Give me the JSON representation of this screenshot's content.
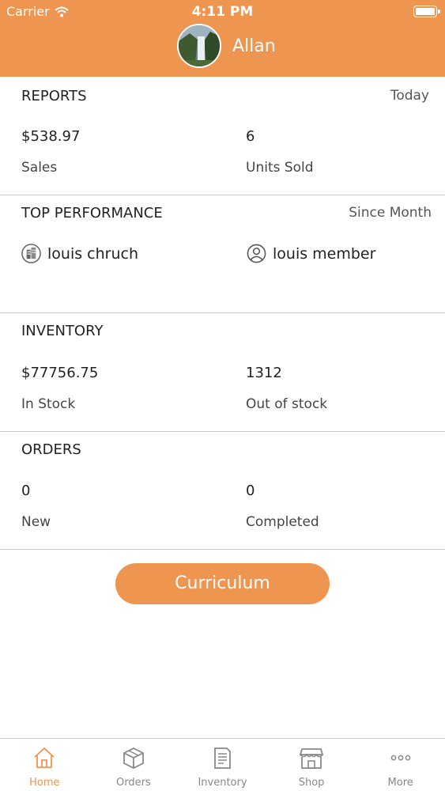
{
  "status_bar": {
    "carrier": "Carrier",
    "time": "4:11 PM"
  },
  "header": {
    "user_name": "Allan"
  },
  "reports": {
    "title": "REPORTS",
    "period": "Today",
    "sales_value": "$538.97",
    "sales_label": "Sales",
    "units_value": "6",
    "units_label": "Units Sold"
  },
  "top_performance": {
    "title": "TOP PERFORMANCE",
    "period": "Since Month",
    "store_name": "louis chruch",
    "member_name": "louis member"
  },
  "inventory": {
    "title": "INVENTORY",
    "in_stock_value": "$77756.75",
    "in_stock_label": "In Stock",
    "out_value": "1312",
    "out_label": "Out of stock"
  },
  "orders": {
    "title": "ORDERS",
    "new_value": "0",
    "new_label": "New",
    "completed_value": "0",
    "completed_label": "Completed"
  },
  "button": {
    "label": "Curriculum"
  },
  "tabs": [
    {
      "label": "Home",
      "icon": "home-icon",
      "active": true
    },
    {
      "label": "Orders",
      "icon": "box-icon"
    },
    {
      "label": "Inventory",
      "icon": "document-icon"
    },
    {
      "label": "Shop",
      "icon": "store-icon"
    },
    {
      "label": "More",
      "icon": "more-dots-icon"
    }
  ],
  "colors": {
    "accent": "#ee9550",
    "divider": "#cfcfcf"
  }
}
